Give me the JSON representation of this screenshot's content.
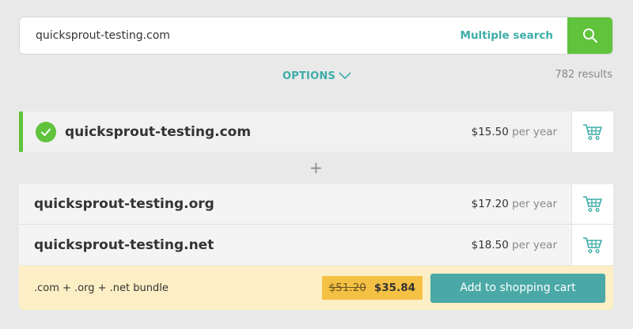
{
  "search": {
    "value": "quicksprout-testing.com",
    "multiple_label": "Multiple search"
  },
  "options_label": "OPTIONS",
  "results_count": "782 results",
  "main_result": {
    "domain": "quicksprout-testing.com",
    "price": "$15.50",
    "period": "per year"
  },
  "plus_symbol": "+",
  "other_results": [
    {
      "domain": "quicksprout-testing.org",
      "price": "$17.20",
      "period": "per year"
    },
    {
      "domain": "quicksprout-testing.net",
      "price": "$18.50",
      "period": "per year"
    }
  ],
  "bundle": {
    "label": ".com + .org + .net bundle",
    "old_price": "$51.20",
    "new_price": "$35.84",
    "button_label": "Add to shopping cart"
  },
  "colors": {
    "accent_green": "#5fc33b",
    "teal": "#3dada8",
    "bundle_bg": "#fdefc5",
    "price_tag": "#f4c144"
  }
}
